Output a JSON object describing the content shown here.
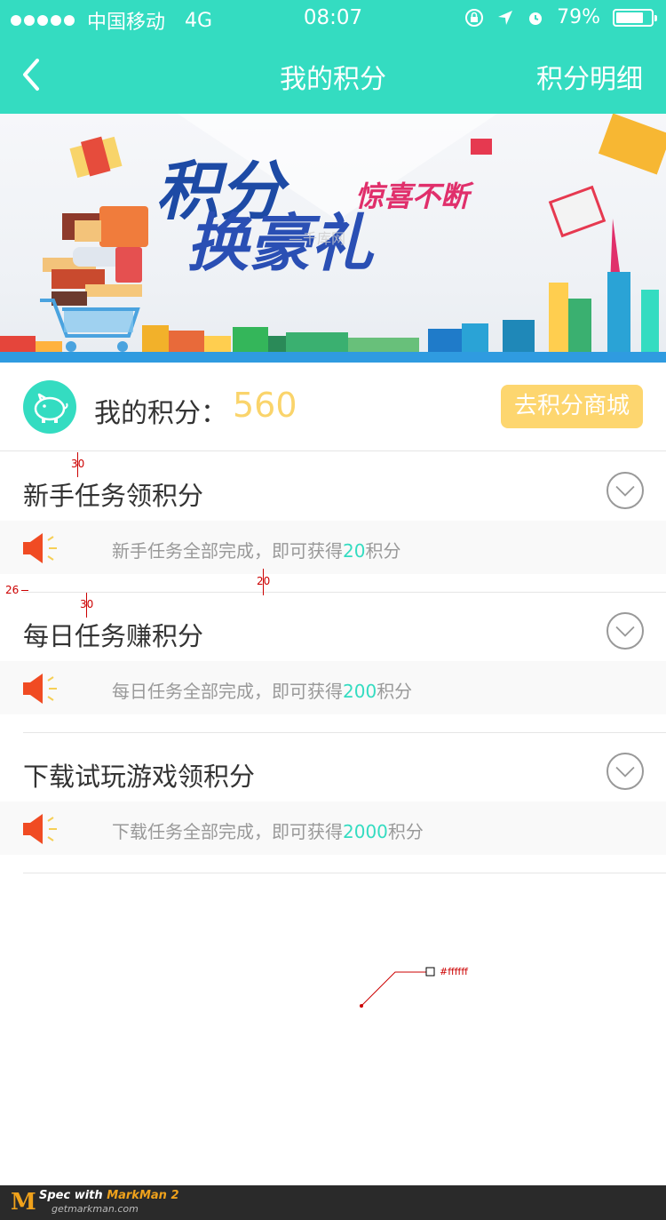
{
  "status_bar": {
    "carrier": "中国移动",
    "network": "4G",
    "time": "08:07",
    "battery_percent": "79%",
    "battery_level": 0.79
  },
  "nav": {
    "title": "我的积分",
    "detail_link": "积分明细"
  },
  "banner": {
    "line1": "积分",
    "line2": "换豪礼",
    "tagline": "惊喜不断"
  },
  "points": {
    "label": "我的积分：",
    "value": "560",
    "mall_button": "去积分商城"
  },
  "tasks": [
    {
      "title": "新手任务领积分",
      "note_prefix": "新手任务全部完成，即可获得",
      "note_amount": "20",
      "note_suffix": "积分"
    },
    {
      "title": "每日任务赚积分",
      "note_prefix": "每日任务全部完成，即可获得",
      "note_amount": "200",
      "note_suffix": "积分"
    },
    {
      "title": "下载试玩游戏领积分",
      "note_prefix": "下载任务全部完成，即可获得",
      "note_amount": "2000",
      "note_suffix": "积分"
    }
  ],
  "annotations": {
    "spacing_a": "30",
    "spacing_b": "26",
    "spacing_c": "20",
    "spacing_d": "30",
    "color_label": "#ffffff"
  },
  "footer": {
    "logo": "M",
    "spec_prefix": "Spec with",
    "spec_brand": "MarkMan 2",
    "site": "getmarkman.com"
  },
  "colors": {
    "accent": "#34dcc1",
    "button": "#fdd66f",
    "points_value": "#fad46b",
    "speaker": "#f04b23"
  },
  "icons": [
    "back-chevron-icon",
    "piggy-bank-icon",
    "chevron-down-icon",
    "speaker-icon",
    "alarm-icon",
    "location-arrow-icon",
    "lock-rotation-icon"
  ]
}
